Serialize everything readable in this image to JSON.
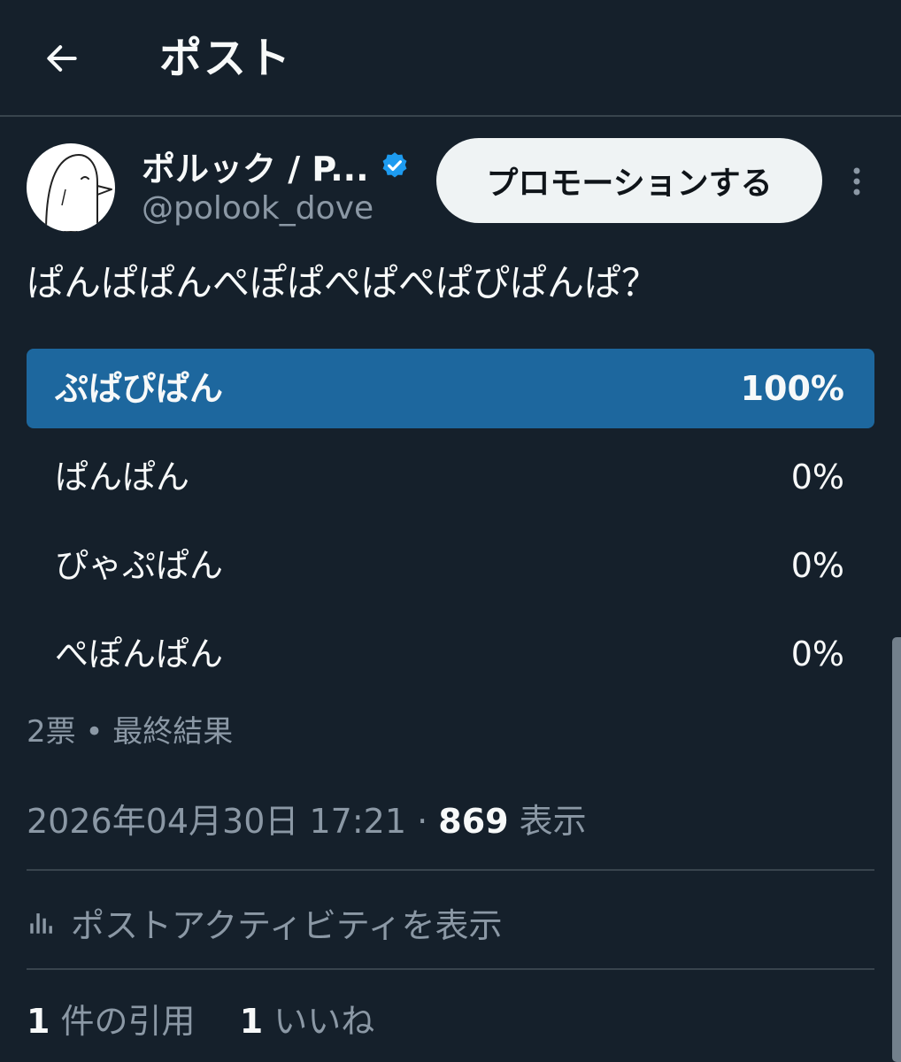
{
  "header": {
    "title": "ポスト"
  },
  "author": {
    "name": "ポルック / P...",
    "handle": "@polook_dove",
    "verified_color": "#1d9bf0"
  },
  "actions": {
    "promote_label": "プロモーションする"
  },
  "post": {
    "question": "ぱんぱぱんぺぽぱぺぱぺぱぴぱんぱ？"
  },
  "poll": {
    "options": [
      {
        "label": "ぷぱぴぱん",
        "percent_label": "100%",
        "percent": 100
      },
      {
        "label": "ぱんぱん",
        "percent_label": "0%",
        "percent": 0
      },
      {
        "label": "ぴゃぷぱん",
        "percent_label": "0%",
        "percent": 0
      },
      {
        "label": "ぺぽんぱん",
        "percent_label": "0%",
        "percent": 0
      }
    ],
    "summary": "2票 • 最終結果",
    "winner_color": "#1d679e"
  },
  "meta": {
    "timestamp": "2026年04月30日 17:21",
    "separator": " · ",
    "views_count": "869",
    "views_label": " 表示"
  },
  "activity": {
    "label": "ポストアクティビティを表示"
  },
  "stats": {
    "quotes_count": "1",
    "quotes_label": " 件の引用",
    "likes_count": "1",
    "likes_label": " いいね"
  }
}
